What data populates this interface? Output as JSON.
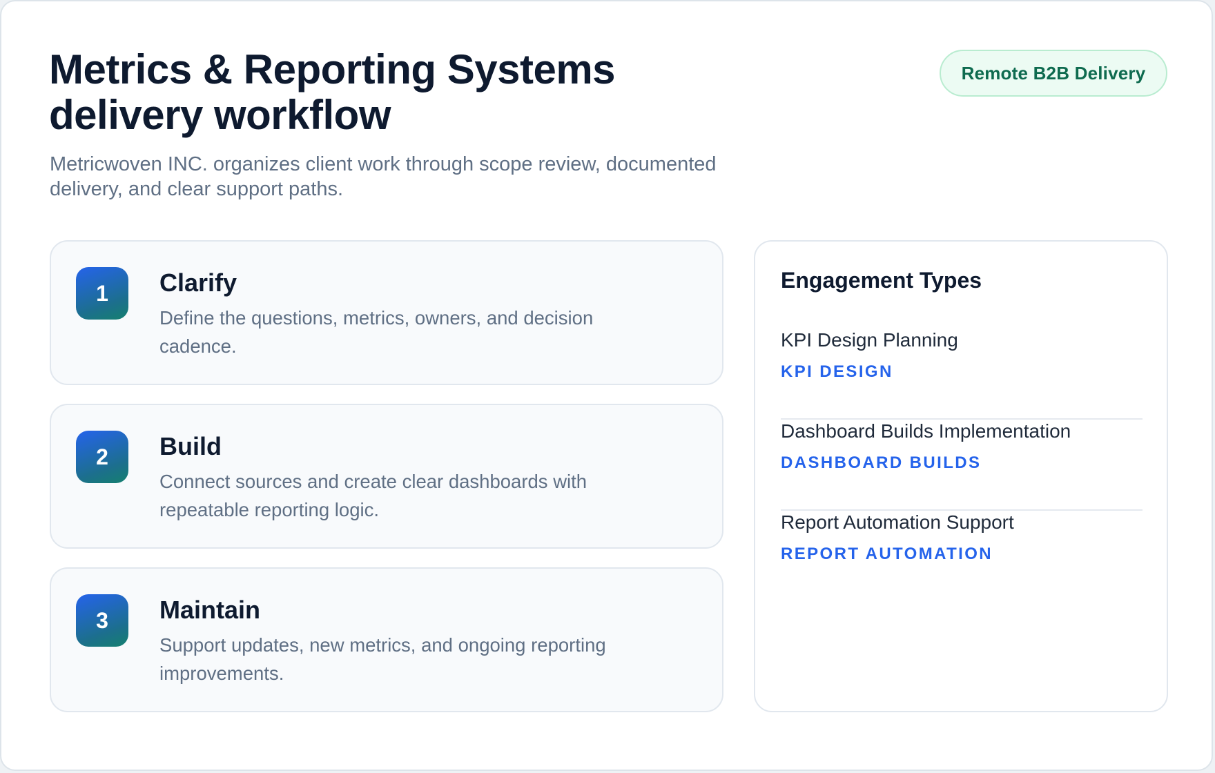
{
  "header": {
    "title": "Metrics & Reporting Systems delivery workflow",
    "badge": "Remote B2B Delivery",
    "subtitle": "Metricwoven INC. organizes client work through scope review, documented delivery, and clear support paths."
  },
  "steps": [
    {
      "number": "1",
      "title": "Clarify",
      "description": "Define the questions, metrics, owners, and decision cadence."
    },
    {
      "number": "2",
      "title": "Build",
      "description": "Connect sources and create clear dashboards with repeatable reporting logic."
    },
    {
      "number": "3",
      "title": "Maintain",
      "description": "Support updates, new metrics, and ongoing reporting improvements."
    }
  ],
  "engagement": {
    "title": "Engagement Types",
    "items": [
      {
        "name": "KPI Design Planning",
        "tag": "KPI DESIGN"
      },
      {
        "name": "Dashboard Builds Implementation",
        "tag": "DASHBOARD BUILDS"
      },
      {
        "name": "Report Automation Support",
        "tag": "REPORT AUTOMATION"
      }
    ]
  },
  "colors": {
    "accent": "#2563eb",
    "badge_text": "#0e6b4f",
    "badge_bg": "#ecfbf3",
    "heading": "#0e1a2f",
    "muted": "#5f6f84"
  }
}
